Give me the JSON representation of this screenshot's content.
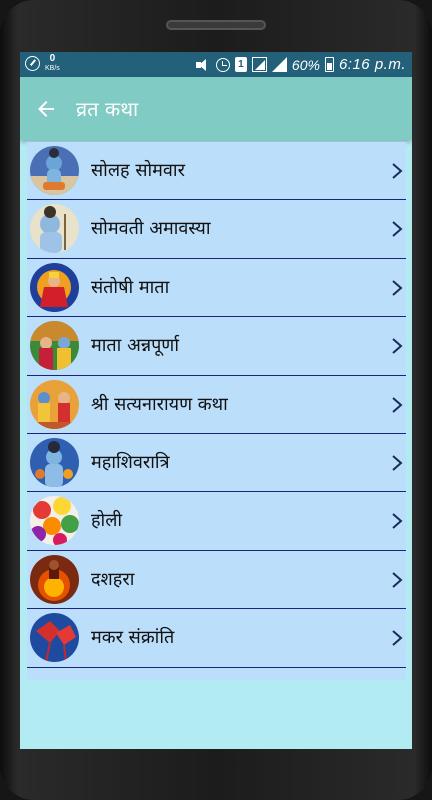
{
  "status_bar": {
    "speed_value": "0",
    "speed_unit": "KB/s",
    "battery": "60%",
    "time": "6:16 p.m."
  },
  "app_bar": {
    "title": "व्रत कथा",
    "back_icon": "arrow-left-icon"
  },
  "colors": {
    "status_bar": "#23607a",
    "app_bar": "#80cbc4",
    "list_bg": "#bbdefb",
    "screen_bg": "#b2ebf2",
    "divider": "#1a237e"
  },
  "list": {
    "chevron_icon": "chevron-right-icon",
    "items": [
      {
        "label": "सोलह सोमवार",
        "thumb": "shiva-image"
      },
      {
        "label": "सोमवती अमावस्या",
        "thumb": "shiva-image"
      },
      {
        "label": "संतोषी माता",
        "thumb": "santoshi-mata-image"
      },
      {
        "label": "माता अन्नपूर्णा",
        "thumb": "annapurna-image"
      },
      {
        "label": "श्री सत्यनारायण कथा",
        "thumb": "satyanarayan-image"
      },
      {
        "label": "महाशिवरात्रि",
        "thumb": "shiva-image"
      },
      {
        "label": "होली",
        "thumb": "holi-colors-image"
      },
      {
        "label": "दशहरा",
        "thumb": "dussehra-image"
      },
      {
        "label": "मकर संक्रांति",
        "thumb": "kites-image"
      }
    ]
  }
}
